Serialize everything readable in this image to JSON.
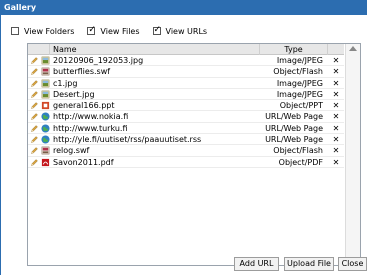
{
  "window": {
    "title": "Gallery"
  },
  "filters": [
    {
      "label": "View Folders",
      "checked": false
    },
    {
      "label": "View Files",
      "checked": true
    },
    {
      "label": "View URLs",
      "checked": true
    }
  ],
  "table": {
    "headers": {
      "name": "Name",
      "type": "Type"
    },
    "rows": [
      {
        "name": "20120906_192053.jpg",
        "type": "Image/JPEG",
        "icon": "image-icon",
        "color": "#6a8c2e"
      },
      {
        "name": "butterflies.swf",
        "type": "Object/Flash",
        "icon": "flash-icon",
        "color": "#b0304a"
      },
      {
        "name": "c1.jpg",
        "type": "Image/JPEG",
        "icon": "image-icon",
        "color": "#6a8c2e"
      },
      {
        "name": "Desert.jpg",
        "type": "Image/JPEG",
        "icon": "image-icon",
        "color": "#6a8c2e"
      },
      {
        "name": "general166.ppt",
        "type": "Object/PPT",
        "icon": "ppt-icon",
        "color": "#d24726"
      },
      {
        "name": "http://www.nokia.fi",
        "type": "URL/Web Page",
        "icon": "globe-icon",
        "color": "#2f7fc1"
      },
      {
        "name": "http://www.turku.fi",
        "type": "URL/Web Page",
        "icon": "globe-icon",
        "color": "#2f7fc1"
      },
      {
        "name": "http://yle.fi/uutiset/rss/paauutiset.rss",
        "type": "URL/Web Page",
        "icon": "globe-icon",
        "color": "#2f7fc1"
      },
      {
        "name": "relog.swf",
        "type": "Object/Flash",
        "icon": "flash-icon",
        "color": "#b0304a"
      },
      {
        "name": "Savon2011.pdf",
        "type": "Object/PDF",
        "icon": "pdf-icon",
        "color": "#c4161c"
      }
    ],
    "delete_symbol": "✕"
  },
  "buttons": {
    "add_url": "Add URL",
    "upload_file": "Upload File",
    "close": "Close"
  },
  "colors": {
    "titlebar": "#2c6db0",
    "pencil": "#d9a441"
  }
}
